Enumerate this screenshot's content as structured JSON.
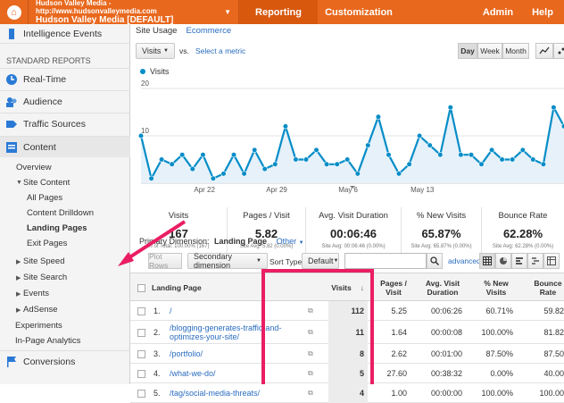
{
  "topbar": {
    "account_url": "Hudson Valley Media - http://www.hudsonvalleymedia.com",
    "account_name": "Hudson Valley Media [DEFAULT]",
    "tabs": [
      "Reporting",
      "Customization",
      "Admin",
      "Help"
    ],
    "colors": {
      "bar": "#e8681d",
      "active": "#d8580e"
    }
  },
  "sidebar": {
    "top_item": "Intelligence Events",
    "section": "STANDARD REPORTS",
    "main": [
      "Real-Time",
      "Audience",
      "Traffic Sources",
      "Content"
    ],
    "content_items": [
      "Overview",
      "Site Content",
      "All Pages",
      "Content Drilldown",
      "Landing Pages",
      "Exit Pages",
      "Site Speed",
      "Site Search",
      "Events",
      "AdSense",
      "Experiments",
      "In-Page Analytics"
    ],
    "bottom": "Conversions",
    "icons": [
      "intelligence-icon",
      "realtime-icon",
      "audience-icon",
      "traffic-icon",
      "content-icon",
      "conversions-flag-icon"
    ]
  },
  "main": {
    "tabs": [
      "Site Usage",
      "Ecommerce"
    ],
    "metric_select": "Visits",
    "vs": "vs.",
    "select_metric": "Select a metric",
    "range_buttons": [
      "Day",
      "Week",
      "Month"
    ],
    "selected_range": "Day"
  },
  "chart_data": {
    "type": "line",
    "legend": "Visits",
    "y_ticks": [
      20,
      10
    ],
    "ylim": [
      0,
      20
    ],
    "x_labels": [
      "Apr 22",
      "Apr 29",
      "May 6",
      "May 13"
    ],
    "values": [
      10,
      1,
      5,
      4,
      6,
      3,
      6,
      1,
      2,
      6,
      2,
      7,
      3,
      4,
      12,
      5,
      5,
      7,
      4,
      4,
      5,
      2,
      8,
      14,
      6,
      2,
      4,
      10,
      8,
      6,
      16,
      6,
      6,
      4,
      7,
      5,
      5,
      7,
      5,
      4,
      16,
      12
    ],
    "color": "#058dc7"
  },
  "metrics": [
    {
      "label": "Visits",
      "value": "167",
      "sub": "% of Total: 100.00% (167)"
    },
    {
      "label": "Pages / Visit",
      "value": "5.82",
      "sub": "Site Avg: 5.82 (0.00%)"
    },
    {
      "label": "Avg. Visit Duration",
      "value": "00:06:46",
      "sub": "Site Avg: 00:06:46 (0.00%)"
    },
    {
      "label": "% New Visits",
      "value": "65.87%",
      "sub": "Site Avg: 65.87% (0.00%)"
    },
    {
      "label": "Bounce Rate",
      "value": "62.28%",
      "sub": "Site Avg: 62.28% (0.00%)"
    }
  ],
  "primary_dimension": {
    "label": "Primary Dimension:",
    "value": "Landing Page",
    "other": "Other"
  },
  "table_controls": {
    "plot_rows": "Plot Rows",
    "secondary": "Secondary dimension",
    "sort_type_label": "Sort Type:",
    "sort_value": "Default",
    "advanced": "advanced"
  },
  "table": {
    "headers": {
      "page": "Landing Page",
      "visits": "Visits",
      "ppv": "Pages / Visit",
      "duration": "Avg. Visit Duration",
      "new": "% New Visits",
      "bounce": "Bounce Rate"
    },
    "rows": [
      {
        "n": "1.",
        "page": "/",
        "visits": "112",
        "ppv": "5.25",
        "dur": "00:06:26",
        "new": "60.71%",
        "bounce": "59.82"
      },
      {
        "n": "2.",
        "page": "/blogging-generates-traffic-and-optimizes-your-site/",
        "visits": "11",
        "ppv": "1.64",
        "dur": "00:00:08",
        "new": "100.00%",
        "bounce": "81.82"
      },
      {
        "n": "3.",
        "page": "/portfolio/",
        "visits": "8",
        "ppv": "2.62",
        "dur": "00:01:00",
        "new": "87.50%",
        "bounce": "87.50"
      },
      {
        "n": "4.",
        "page": "/what-we-do/",
        "visits": "5",
        "ppv": "27.60",
        "dur": "00:38:32",
        "new": "0.00%",
        "bounce": "40.00"
      },
      {
        "n": "5.",
        "page": "/tag/social-media-threats/",
        "visits": "4",
        "ppv": "1.00",
        "dur": "00:00:00",
        "new": "100.00%",
        "bounce": "100.00"
      }
    ]
  },
  "highlight_color": "#ea1e63"
}
